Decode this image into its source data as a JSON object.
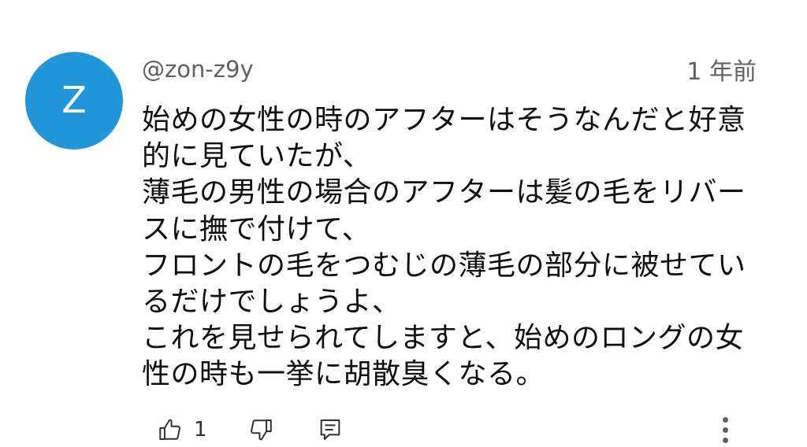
{
  "comment": {
    "avatar_letter": "Z",
    "avatar_color": "#2196d9",
    "author": "@zon-z9y",
    "timestamp": "1 年前",
    "body_lines": [
      "始めの女性の時のアフターはそうなんだと好意",
      "的に見ていたが、",
      "薄毛の男性の場合のアフターは髪の毛をリバー",
      "スに撫で付けて、",
      "フロントの毛をつむじの薄毛の部分に被せてい",
      "るだけでしょうよ、",
      "これを見せられてしますと、始めのロングの女",
      "性の時も一挙に胡散臭くなる。"
    ],
    "like_count": "1"
  },
  "icons": {
    "like": "thumbs-up-icon",
    "dislike": "thumbs-down-icon",
    "reply": "comment-reply-icon",
    "more": "more-vertical-icon"
  }
}
